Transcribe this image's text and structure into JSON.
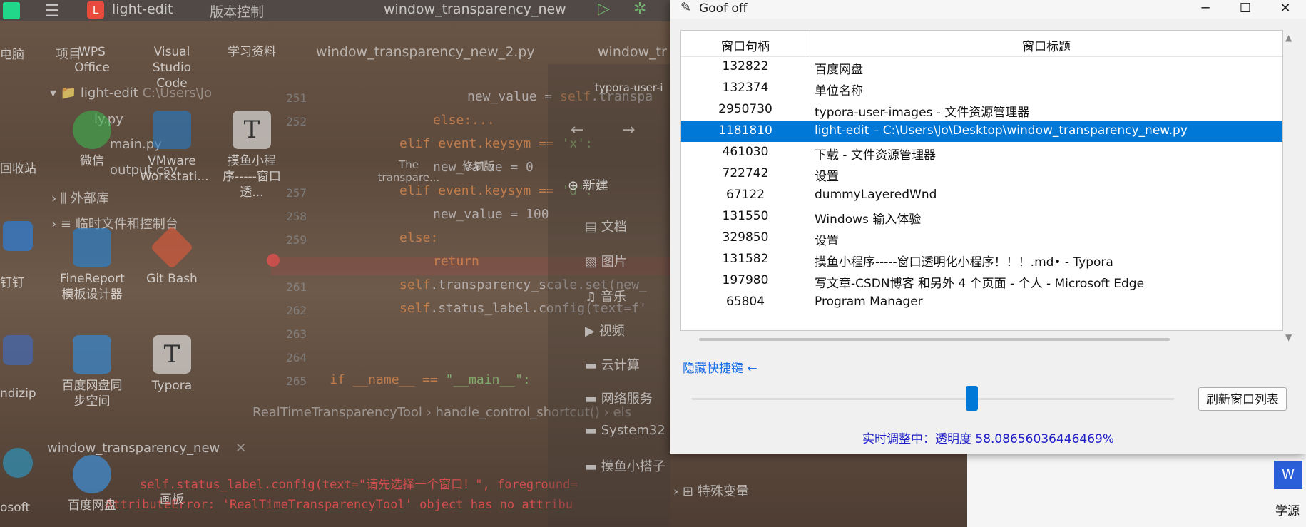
{
  "ide": {
    "project": "light-edit",
    "vcs": "版本控制",
    "run_config": "window_transparency_new",
    "tabs": [
      "window_transparency_new_2.py",
      "window_tr"
    ],
    "tree_root": "light-edit",
    "tree_root_path": "C:\\Users\\Jo",
    "files": [
      "ly.py",
      "main.py",
      "output.csv"
    ],
    "ext_libs": "外部库",
    "scratches": "临时文件和控制台",
    "project_label": "项目",
    "line_numbers": [
      "251",
      "252",
      "",
      "257",
      "258",
      "259",
      "",
      "261",
      "262",
      "263",
      "264",
      "265"
    ],
    "code_lines": [
      {
        "a": "new_value = ",
        "b": "self",
        "c": ".transpa"
      },
      {
        "a": "else:...",
        "b": "",
        "c": ""
      },
      {
        "a": "elif event.keysym == ",
        "b": "",
        "c": "'x':"
      },
      {
        "a": "new_value = 0",
        "b": "",
        "c": ""
      },
      {
        "a": "elif event.keysym == ",
        "b": "",
        "c": "'d':"
      },
      {
        "a": "new_value = 100",
        "b": "",
        "c": ""
      },
      {
        "a": "else:",
        "b": "",
        "c": ""
      },
      {
        "a": "return",
        "b": "",
        "c": ""
      },
      {
        "a": "self",
        "b": ".transparency_scale.set(new_",
        "c": ""
      },
      {
        "a": "self",
        "b": ".status_label.config(text=f'",
        "c": ""
      },
      {
        "a": "if __name__ == ",
        "b": "",
        "c": "\"__main__\":"
      }
    ],
    "breadcrumb1": "RealTimeTransparencyTool",
    "breadcrumb2": "handle_control_shortcut()",
    "breadcrumb3": "els",
    "run_tab": "window_transparency_new",
    "error_line1": "self.status_label.config(text=\"请先选择一个窗口！\", foreground=",
    "error_line2": "AttributeError: 'RealTimeTransparencyTool' object has no attribu"
  },
  "desktop": {
    "icons": [
      "WPS Office",
      "Visual Studio Code",
      "学习资料",
      "微信",
      "VMware Workstati...",
      "摸鱼小程序-----窗口透...",
      "FineReport 模板设计器",
      "Git Bash",
      "百度网盘同步空间",
      "Typora",
      "百度网盘",
      "画板"
    ],
    "left_labels": [
      "电脑",
      "回收站",
      "钉钉",
      "ndizip",
      "osoft"
    ],
    "right_label": "学源"
  },
  "explorer": {
    "title": "typora-user-i",
    "new_button": "新建",
    "items": [
      "文档",
      "图片",
      "音乐",
      "视频",
      "云计算",
      "网络服务",
      "System32",
      "摸鱼小搭子"
    ],
    "special_vars": "特殊变量",
    "file_labels": [
      "The transpare...",
      "修复版"
    ]
  },
  "app": {
    "title": "Goof off",
    "columns": [
      "窗口句柄",
      "窗口标题"
    ],
    "rows": [
      {
        "handle": "132822",
        "title": "百度网盘"
      },
      {
        "handle": "132374",
        "title": "单位名称"
      },
      {
        "handle": "2950730",
        "title": "typora-user-images - 文件资源管理器"
      },
      {
        "handle": "1181810",
        "title": "light-edit – C:\\Users\\Jo\\Desktop\\window_transparency_new.py"
      },
      {
        "handle": "461030",
        "title": "下载 - 文件资源管理器"
      },
      {
        "handle": "722742",
        "title": "设置"
      },
      {
        "handle": "67122",
        "title": "dummyLayeredWnd"
      },
      {
        "handle": "131550",
        "title": "Windows 输入体验"
      },
      {
        "handle": "329850",
        "title": "设置"
      },
      {
        "handle": "131582",
        "title": "摸鱼小程序-----窗口透明化小程序！！！.md• - Typora"
      },
      {
        "handle": "197980",
        "title": "写文章-CSDN博客 和另外 4 个页面 - 个人 - Microsoft Edge"
      },
      {
        "handle": "65804",
        "title": "Program Manager"
      }
    ],
    "selected_index": 3,
    "hide_shortcuts": "隐藏快捷键 ←",
    "refresh_button": "刷新窗口列表",
    "transparency_value": 58.08656036446469,
    "status": "实时调整中：透明度 58.08656036446469%",
    "colors": {
      "selection": "#0078d7",
      "link": "#1f6fe5",
      "status": "#1e1ec8"
    }
  }
}
